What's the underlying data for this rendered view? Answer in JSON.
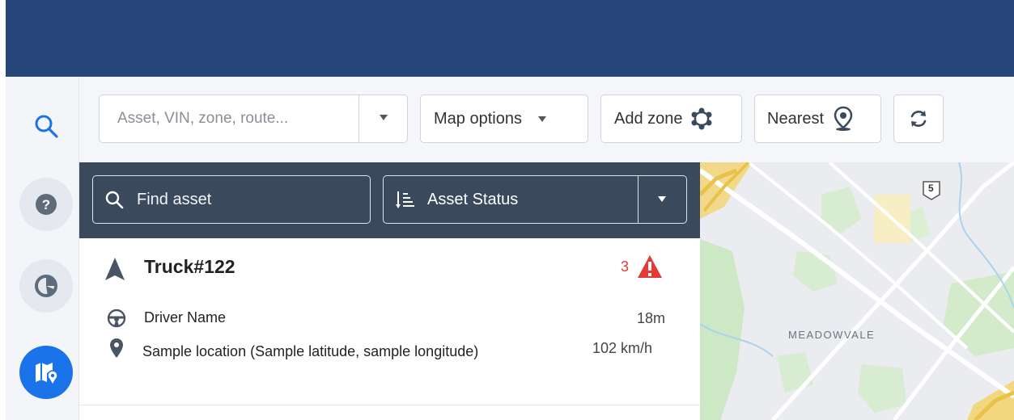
{
  "toolbar": {
    "search_placeholder": "Asset, VIN, zone, route...",
    "map_options_label": "Map options",
    "add_zone_label": "Add zone",
    "nearest_label": "Nearest"
  },
  "panel": {
    "find_placeholder": "Find asset",
    "sort_label": "Asset Status"
  },
  "asset": {
    "name": "Truck#122",
    "alert_count": "3",
    "driver": "Driver Name",
    "duration": "18m",
    "location": "Sample location (Sample latitude, sample longitude)",
    "speed": "102 km/h"
  },
  "map": {
    "area_label": "MEADOWVALE",
    "highway_shield": "5"
  },
  "colors": {
    "topbar": "#26467a",
    "accent": "#1a73e8",
    "panel_header": "#3a4a5c",
    "alert": "#e53935"
  },
  "icons": {
    "nav": [
      "search-icon",
      "help-icon",
      "reports-icon",
      "map-icon"
    ],
    "toolbar": [
      "chevron-down-icon",
      "zone-icon",
      "location-pin-icon",
      "refresh-icon"
    ]
  }
}
